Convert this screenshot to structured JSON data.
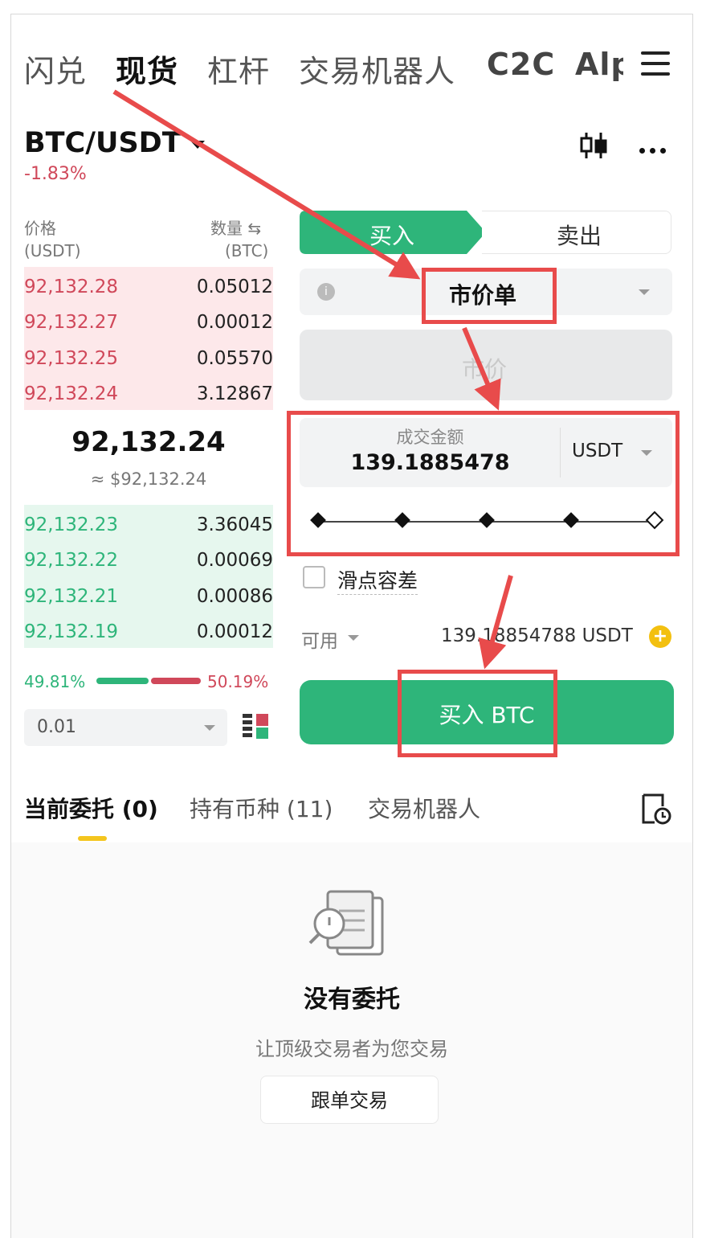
{
  "top_tabs": [
    {
      "label": "闪兑"
    },
    {
      "label": "现货"
    },
    {
      "label": "杠杆"
    },
    {
      "label": "交易机器人"
    },
    {
      "label": "C2C"
    },
    {
      "label": "Alp"
    }
  ],
  "active_top_tab": "现货",
  "pair": {
    "symbol": "BTC/USDT",
    "change": "-1.83%"
  },
  "orderbook": {
    "price_header": "价格",
    "price_unit": "(USDT)",
    "qty_header": "数量 ⇆",
    "qty_unit": "(BTC)",
    "asks": [
      {
        "price": "92,132.28",
        "qty": "0.05012"
      },
      {
        "price": "92,132.27",
        "qty": "0.00012"
      },
      {
        "price": "92,132.25",
        "qty": "0.05570"
      },
      {
        "price": "92,132.24",
        "qty": "3.12867"
      }
    ],
    "mid_price": "92,132.24",
    "mid_usd": "≈ $92,132.24",
    "bids": [
      {
        "price": "92,132.23",
        "qty": "3.36045"
      },
      {
        "price": "92,132.22",
        "qty": "0.00069"
      },
      {
        "price": "92,132.21",
        "qty": "0.00086"
      },
      {
        "price": "92,132.19",
        "qty": "0.00012"
      }
    ],
    "buy_ratio": "49.81%",
    "sell_ratio": "50.19%",
    "precision": "0.01"
  },
  "trade": {
    "buy_tab": "买入",
    "sell_tab": "卖出",
    "order_type": "市价单",
    "price_placeholder": "市价",
    "amount_label": "成交金额",
    "amount_value": "139.1885478",
    "amount_unit": "USDT",
    "slider_fraction": 1.0,
    "slippage_label": "滑点容差",
    "available_label": "可用",
    "available_value": "139.18854788 USDT",
    "buy_button": "买入 BTC"
  },
  "bottom_tabs": [
    {
      "label": "当前委托 (0)"
    },
    {
      "label": "持有币种 (11)"
    },
    {
      "label": "交易机器人"
    }
  ],
  "empty_state": {
    "title": "没有委托",
    "subtitle": "让顶级交易者为您交易",
    "button": "跟单交易"
  },
  "colors": {
    "buy_green": "#2eb57a",
    "sell_red": "#d0485a",
    "highlight_red": "#e84b4b",
    "tab_indicator": "#f4c51e"
  },
  "icons": [
    "menu-icon",
    "caret-down-icon",
    "candlestick-icon",
    "more-icon",
    "info-icon",
    "checkbox-icon",
    "plus-circle-icon",
    "order-history-icon",
    "empty-document-icon",
    "layout-icon"
  ]
}
